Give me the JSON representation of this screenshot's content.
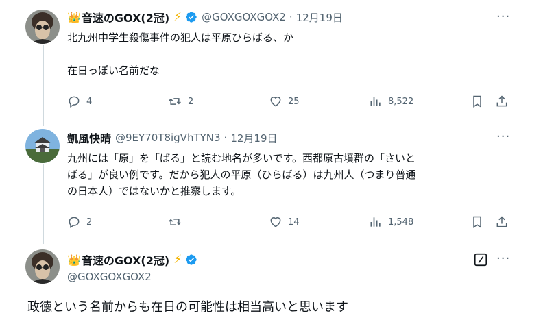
{
  "tweet1": {
    "name": "音速のGOX(2冠)",
    "handle": "@GOXGOXGOX2",
    "date": "12月19日",
    "line1": "北九州中学生殺傷事件の犯人は平原ひらばる、か",
    "line2": "在日っぽい名前だな",
    "replies": "4",
    "retweets": "2",
    "likes": "25",
    "views": "8,522"
  },
  "tweet2": {
    "name": "凱風快晴",
    "handle": "@9EY70T8igVhTYN3",
    "date": "12月19日",
    "line1": "九州には「原」を「ばる」と読む地名が多いです。西都原古墳群の「さいと",
    "line2": "ばる」が良い例です。だから犯人の平原（ひらばる）は九州人（つまり普通",
    "line3": "の日本人）ではないかと推察します。",
    "replies": "2",
    "retweets": "",
    "likes": "14",
    "views": "1,548"
  },
  "tweet3": {
    "name": "音速のGOX(2冠)",
    "handle": "@GOXGOXGOX2",
    "text": "政徳という名前からも在日の可能性は相当高いと思います"
  },
  "icons": {
    "crown": "👑",
    "bolt": "⚡",
    "more": "···"
  },
  "colors": {
    "verified": "#1d9bf0",
    "muted": "#536471",
    "thread_line": "#cfd9de"
  }
}
